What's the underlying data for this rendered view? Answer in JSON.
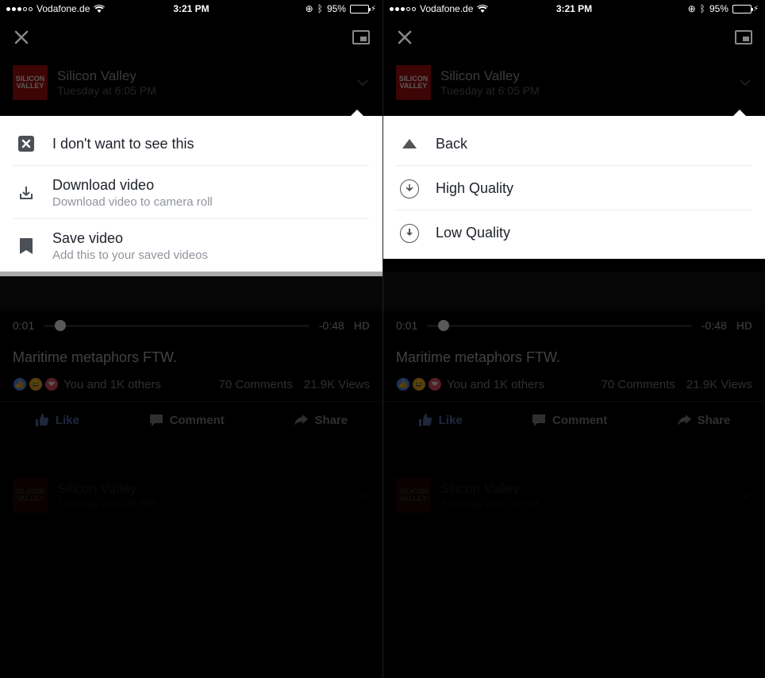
{
  "status": {
    "carrier": "Vodafone.de",
    "time": "3:21 PM",
    "battery_pct": "95%"
  },
  "post": {
    "page_name": "Silicon Valley",
    "page_avatar_text": "SILICON\nVALLEY",
    "timestamp": "Tuesday at 6:05 PM",
    "caption": "Maritime metaphors FTW.",
    "likes_text": "You and 1K others",
    "comments_text": "70 Comments",
    "views_text": "21.9K Views",
    "elapsed": "0:01",
    "remaining": "-0:48",
    "quality_badge": "HD"
  },
  "actions": {
    "like": "Like",
    "comment": "Comment",
    "share": "Share"
  },
  "left_menu": {
    "hide": {
      "label": "I don't want to see this"
    },
    "download": {
      "label": "Download video",
      "sub": "Download video to camera roll"
    },
    "save": {
      "label": "Save video",
      "sub": "Add this to your saved videos"
    }
  },
  "right_menu": {
    "back": "Back",
    "high": "High Quality",
    "low": "Low Quality"
  }
}
